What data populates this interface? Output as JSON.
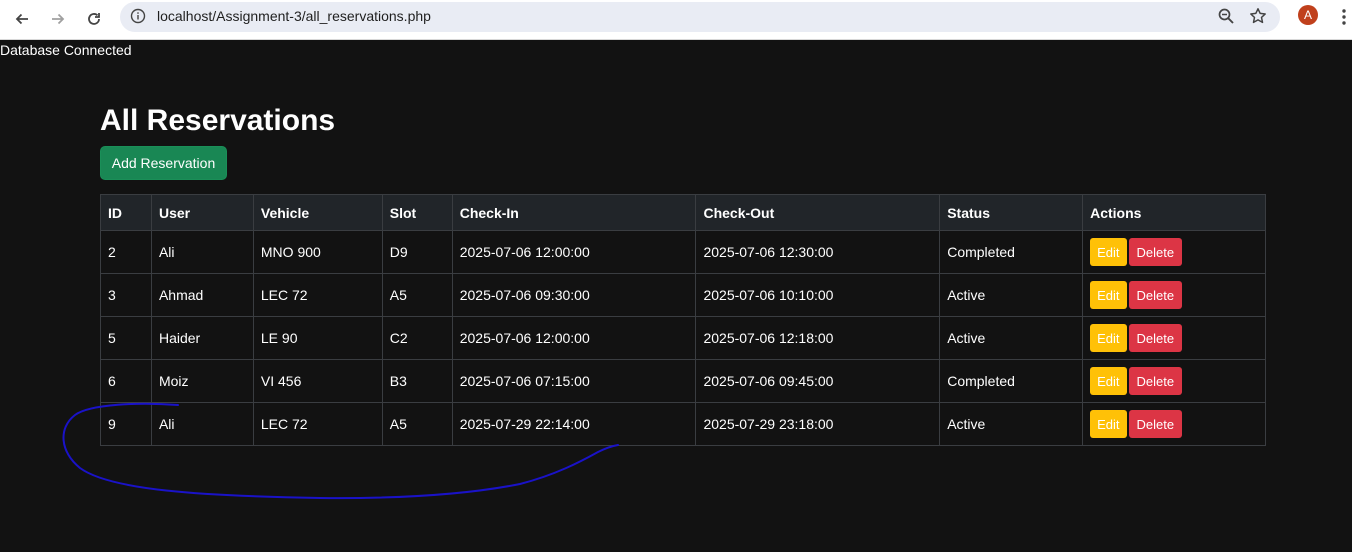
{
  "browser": {
    "url": "localhost/Assignment-3/all_reservations.php",
    "profile_initial": "A"
  },
  "page": {
    "db_status": "Database Connected",
    "title": "All Reservations",
    "add_button": "Add Reservation"
  },
  "table": {
    "headers": [
      "ID",
      "User",
      "Vehicle",
      "Slot",
      "Check-In",
      "Check-Out",
      "Status",
      "Actions"
    ],
    "rows": [
      {
        "id": "2",
        "user": "Ali",
        "vehicle": "MNO 900",
        "slot": "D9",
        "check_in": "2025-07-06 12:00:00",
        "check_out": "2025-07-06 12:30:00",
        "status": "Completed"
      },
      {
        "id": "3",
        "user": "Ahmad",
        "vehicle": "LEC 72",
        "slot": "A5",
        "check_in": "2025-07-06 09:30:00",
        "check_out": "2025-07-06 10:10:00",
        "status": "Active"
      },
      {
        "id": "5",
        "user": "Haider",
        "vehicle": "LE 90",
        "slot": "C2",
        "check_in": "2025-07-06 12:00:00",
        "check_out": "2025-07-06 12:18:00",
        "status": "Active"
      },
      {
        "id": "6",
        "user": "Moiz",
        "vehicle": "VI 456",
        "slot": "B3",
        "check_in": "2025-07-06 07:15:00",
        "check_out": "2025-07-06 09:45:00",
        "status": "Completed"
      },
      {
        "id": "9",
        "user": "Ali",
        "vehicle": "LEC 72",
        "slot": "A5",
        "check_in": "2025-07-29 22:14:00",
        "check_out": "2025-07-29 23:18:00",
        "status": "Active"
      }
    ],
    "edit_label": "Edit",
    "delete_label": "Delete"
  },
  "colors": {
    "background": "#121212",
    "success": "#198754",
    "warning": "#ffc107",
    "danger": "#dc3545",
    "annotation": "#1a12c8"
  },
  "icons": {
    "back": "back-arrow-icon",
    "forward": "forward-arrow-icon",
    "reload": "reload-icon",
    "info": "info-icon",
    "zoom": "zoom-icon",
    "bookmark": "star-icon",
    "menu": "kebab-menu-icon"
  }
}
